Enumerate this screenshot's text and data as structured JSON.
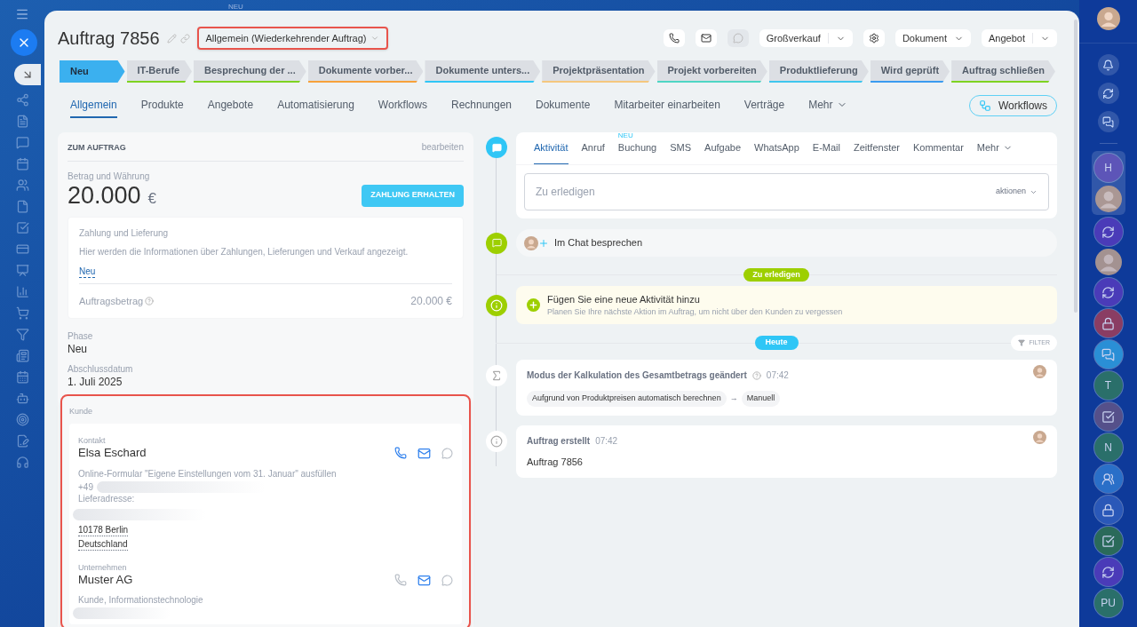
{
  "background_label": "NEU",
  "header": {
    "title": "Auftrag 7856",
    "category": {
      "value": "Allgemein (Wiederkehrender Auftrag)",
      "highlighted": true
    },
    "buttons": [
      {
        "label": "Großverkauf",
        "kind": "split"
      },
      {
        "label": "Dokument",
        "kind": "dropdown"
      },
      {
        "label": "Angebot",
        "kind": "split"
      }
    ]
  },
  "stages": [
    {
      "label": "Neu",
      "selected": true,
      "color": "#3bb0ef"
    },
    {
      "label": "IT-Berufe",
      "selected": false,
      "color": "#7ed321"
    },
    {
      "label": "Besprechung der ...",
      "selected": false,
      "color": "#7ed321"
    },
    {
      "label": "Dokumente vorber...",
      "selected": false,
      "color": "#f7a23b"
    },
    {
      "label": "Dokumente unters...",
      "selected": false,
      "color": "#2fc6f6"
    },
    {
      "label": "Projektpräsentation",
      "selected": false,
      "color": "#f5c77e"
    },
    {
      "label": "Projekt vorbereiten",
      "selected": false,
      "color": "#4fd6c4"
    },
    {
      "label": "Produktlieferung",
      "selected": false,
      "color": "#3fc6ee"
    },
    {
      "label": "Wird geprüft",
      "selected": false,
      "color": "#3a9bf0"
    },
    {
      "label": "Auftrag schließen",
      "selected": false,
      "color": "#7ed321"
    }
  ],
  "tabs": [
    {
      "label": "Allgemein",
      "selected": true
    },
    {
      "label": "Produkte",
      "selected": false
    },
    {
      "label": "Angebote",
      "selected": false
    },
    {
      "label": "Automatisierung",
      "selected": false
    },
    {
      "label": "Workflows",
      "selected": false
    },
    {
      "label": "Rechnungen",
      "selected": false
    },
    {
      "label": "Dokumente",
      "selected": false
    },
    {
      "label": "Mitarbeiter einarbeiten",
      "selected": false
    },
    {
      "label": "Verträge",
      "selected": false
    },
    {
      "label": "Mehr",
      "selected": false
    }
  ],
  "workflows_button": "Workflows",
  "order_card": {
    "title": "ZUM AUFTRAG",
    "edit": "bearbeiten",
    "amount_label": "Betrag und Währung",
    "amount": "20.000",
    "currency": "€",
    "pay_button": "ZAHLUNG ERHALTEN",
    "payment": {
      "title": "Zahlung und Lieferung",
      "description": "Hier werden die Informationen über Zahlungen, Lieferungen und Verkauf angezeigt.",
      "link": "Neu",
      "total_label": "Auftragsbetrag",
      "total": "20.000 €"
    },
    "fields": [
      {
        "label": "Phase",
        "value": "Neu"
      },
      {
        "label": "Abschlussdatum",
        "value": "1. Juli 2025"
      }
    ],
    "customer": {
      "label": "Kunde",
      "highlighted": true,
      "contact": {
        "type": "Kontakt",
        "name": "Elsa Eschard",
        "phone_available": true,
        "source": "Online-Formular \"Eigene Einstellungen vom 31. Januar\" ausfüllen",
        "phone_prefix": "+49",
        "address_label": "Lieferadresse:",
        "address_lines": [
          "10178 Berlin",
          "Deutschland"
        ]
      },
      "company": {
        "type": "Unternehmen",
        "name": "Muster AG",
        "phone_available": false,
        "description": "Kunde, Informationstechnologie"
      }
    }
  },
  "activity": {
    "tabs": [
      {
        "label": "Aktivität",
        "selected": true
      },
      {
        "label": "Anruf",
        "selected": false
      },
      {
        "label": "Buchung",
        "selected": false,
        "badge": "NEU"
      },
      {
        "label": "SMS",
        "selected": false
      },
      {
        "label": "Aufgabe",
        "selected": false
      },
      {
        "label": "WhatsApp",
        "selected": false
      },
      {
        "label": "E-Mail",
        "selected": false
      },
      {
        "label": "Zeitfenster",
        "selected": false
      },
      {
        "label": "Kommentar",
        "selected": false
      },
      {
        "label": "Mehr",
        "selected": false
      }
    ],
    "placeholder": "Zu erledigen",
    "actions": "aktionen"
  },
  "chat": "Im Chat besprechen",
  "todo_badge": "Zu erledigen",
  "suggestion": {
    "title": "Fügen Sie eine neue Aktivität hinzu",
    "text": "Planen Sie Ihre nächste Aktion im Auftrag, um nicht über den Kunden zu vergessen"
  },
  "today_badge": "Heute",
  "filter": "FILTER",
  "history": [
    {
      "kind": "change",
      "title": "Modus der Kalkulation des Gesamtbetrags geändert",
      "time": "07:42",
      "from": "Aufgrund von Produktpreisen automatisch berechnen",
      "arrow": "→",
      "to": "Manuell"
    },
    {
      "kind": "created",
      "title": "Auftrag erstellt",
      "time": "07:42",
      "body": "Auftrag 7856"
    }
  ],
  "right_rail": [
    {
      "kind": "letter",
      "text": "H",
      "color": "#5d55b8",
      "selected": true
    },
    {
      "kind": "avatar",
      "selected": true
    },
    {
      "kind": "sync",
      "color": "#4a3bb8",
      "selected": false
    },
    {
      "kind": "avatar",
      "selected": false
    },
    {
      "kind": "sync",
      "color": "#4a3bb8",
      "selected": false
    },
    {
      "kind": "lock",
      "color": "#8a3d63",
      "selected": false
    },
    {
      "kind": "chat",
      "color": "#2a8fd6",
      "selected": false
    },
    {
      "kind": "letter",
      "text": "T",
      "color": "#2a6f6a",
      "selected": false
    },
    {
      "kind": "task",
      "color": "#55508a",
      "selected": false
    },
    {
      "kind": "letter",
      "text": "N",
      "color": "#2a6f6a",
      "selected": false
    },
    {
      "kind": "team",
      "color": "#2a6fc8",
      "selected": false
    },
    {
      "kind": "lock",
      "color": "#2a58b8",
      "selected": false
    },
    {
      "kind": "task",
      "color": "#2a6a5a",
      "selected": false
    },
    {
      "kind": "sync",
      "color": "#4a3bb8",
      "selected": false
    },
    {
      "kind": "letter",
      "text": "PU",
      "color": "#2a6f6a",
      "selected": false
    }
  ]
}
